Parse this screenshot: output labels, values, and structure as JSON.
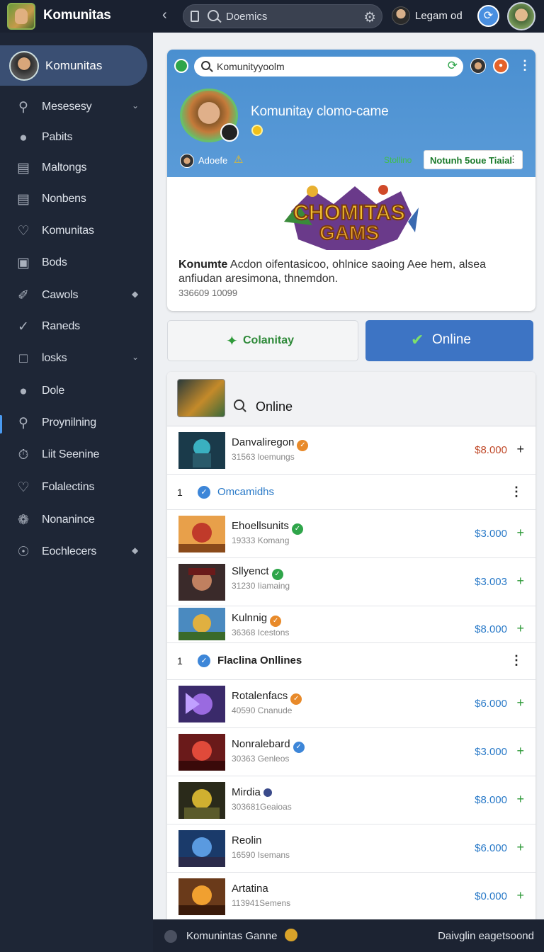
{
  "colors": {
    "accent": "#3d74c4",
    "sidebar_bg": "#1e2636",
    "banner": "#4a8fd0",
    "price_blue": "#2a7ac8",
    "price_red": "#c04a2a",
    "plus_green": "#2f9a3a"
  },
  "app": {
    "title": "Komunitas"
  },
  "topbar": {
    "search_value": "Doemics",
    "user_name": "Legam od"
  },
  "sidebar": {
    "active_label": "Komunitas",
    "items": [
      {
        "label": "Mesesesy",
        "icon": "search-icon"
      },
      {
        "label": "Pabits",
        "icon": "person-icon"
      },
      {
        "label": "Maltongs",
        "icon": "briefcase-icon"
      },
      {
        "label": "Nonbens",
        "icon": "list-icon"
      },
      {
        "label": "Komunitas",
        "icon": "diamond-icon"
      },
      {
        "label": "Bods",
        "icon": "box-icon"
      },
      {
        "label": "Cawols",
        "icon": "pen-icon"
      },
      {
        "label": "Raneds",
        "icon": "check-icon"
      },
      {
        "label": "losks",
        "icon": "square-icon"
      },
      {
        "label": "Dole",
        "icon": "user-alert-icon"
      },
      {
        "label": "Proynilning",
        "icon": "search-icon"
      },
      {
        "label": "Liit Seenine",
        "icon": "timer-icon"
      },
      {
        "label": "Folalectins",
        "icon": "gift-icon"
      },
      {
        "label": "Nonanince",
        "icon": "puzzle-icon"
      },
      {
        "label": "Eochlecers",
        "icon": "circle-icon"
      }
    ]
  },
  "card": {
    "search_value": "Komunityyoolm",
    "group_name": "Komunitay clomo-came",
    "owner": "Adoefe",
    "status": "Stollino",
    "tag_label": "Notunh 5oue Tiaial",
    "tag_dots": "⋮",
    "logo_line1": "CHOMITAS",
    "logo_line2": "GAMS",
    "desc_bold": "Konumte",
    "desc_text": " Acdon oifentasicoo, ohlnice saoing Aee hem, alsea anfiudan aresimona, thnemdon.",
    "meta": "336609 10099"
  },
  "buttons": {
    "community": "Colanitay",
    "online": "Online"
  },
  "list": {
    "header": "Online",
    "sections": [
      {
        "num": "1",
        "label": "Omcamidhs"
      },
      {
        "num": "1",
        "label": "Flaclina Onllines"
      }
    ],
    "rows": [
      {
        "name": "Danvaliregon",
        "sub": "31563 loemungs",
        "price": "$8.000"
      },
      {
        "name": "Ehoellsunits",
        "sub": "19333 Komang",
        "price": "$3.000"
      },
      {
        "name": "Sllyenct",
        "sub": "31230 Iiamaing",
        "price": "$3.003"
      },
      {
        "name": "Kulnnig",
        "sub": "36368 Icestons",
        "price": "$8.000"
      },
      {
        "name": "Rotalenfacs",
        "sub": "40590 Cnanude",
        "price": "$6.000"
      },
      {
        "name": "Nonralebard",
        "sub": "30363 Genleos",
        "price": "$3.000"
      },
      {
        "name": "Mirdia",
        "sub": "303681Geaioas",
        "price": "$8.000"
      },
      {
        "name": "Reolin",
        "sub": "16590 Isemans",
        "price": "$6.000"
      },
      {
        "name": "Artatina",
        "sub": "113941Semens",
        "price": "$0.000"
      }
    ]
  },
  "bottom": {
    "left_label": "Komunintas Ganne",
    "right_label": "Daivglin eagetsoond"
  }
}
